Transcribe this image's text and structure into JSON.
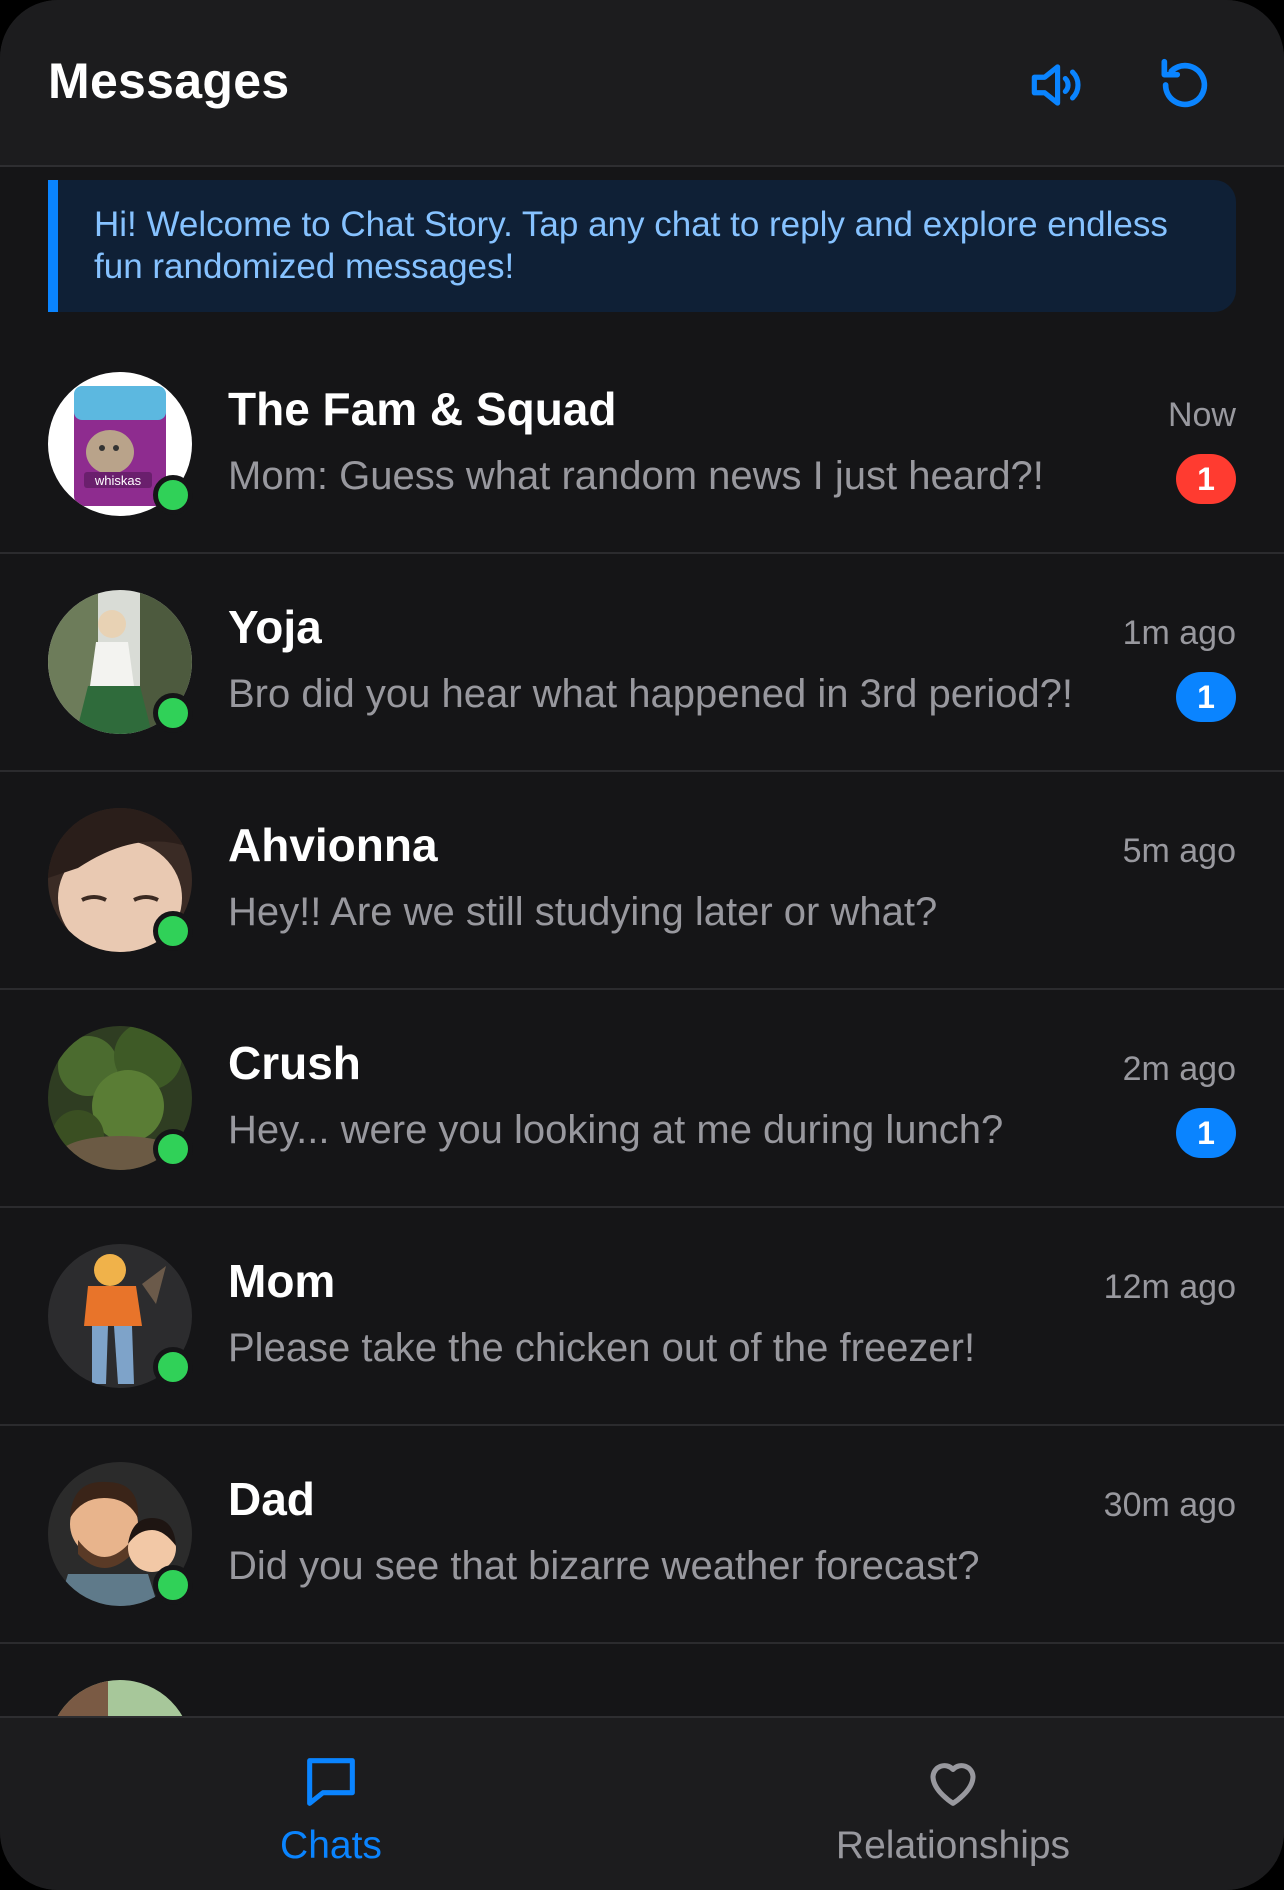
{
  "header": {
    "title": "Messages",
    "sound_icon": "speaker-wave-icon",
    "refresh_icon": "refresh-icon",
    "accent": "#0a84ff"
  },
  "banner": {
    "line1": "Hi! Welcome to Chat Story. Tap any chat to reply and explore endless",
    "line2": "fun randomized messages!"
  },
  "chats": [
    {
      "name": "The Fam & Squad",
      "preview": "Mom: Guess what random news I just heard?!",
      "time": "Now",
      "badge": "1",
      "badge_color": "#ff3b30",
      "online": true
    },
    {
      "name": "Yoja",
      "preview": "Bro did you hear what happened in 3rd period?!",
      "time": "1m ago",
      "badge": "1",
      "badge_color": "#0a84ff",
      "online": true
    },
    {
      "name": "Ahvionna",
      "preview": "Hey!! Are we still studying later or what?",
      "time": "5m ago",
      "badge": "",
      "online": true
    },
    {
      "name": "Crush",
      "preview": "Hey... were you looking at me during lunch?",
      "time": "2m ago",
      "badge": "1",
      "badge_color": "#0a84ff",
      "online": true
    },
    {
      "name": "Mom",
      "preview": "Please take the chicken out of the freezer!",
      "time": "12m ago",
      "badge": "",
      "online": true
    },
    {
      "name": "Dad",
      "preview": "Did you see that bizarre weather forecast?",
      "time": "30m ago",
      "badge": "",
      "online": true
    }
  ],
  "nav": {
    "chats_label": "Chats",
    "relationships_label": "Relationships",
    "chats_icon": "chat-bubble-icon",
    "relationships_icon": "heart-icon"
  },
  "colors": {
    "online": "#30d158",
    "unread_red": "#ff3b30",
    "unread_blue": "#0a84ff"
  }
}
